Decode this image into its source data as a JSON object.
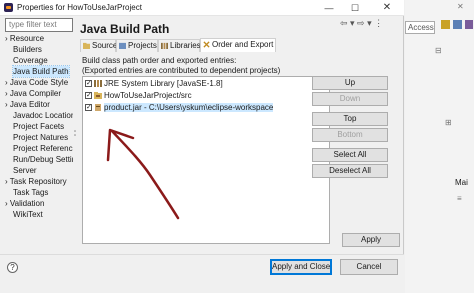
{
  "window": {
    "title": "Properties for HowToUseJarProject",
    "min": "—",
    "max": "☐",
    "close": "✕"
  },
  "filter": {
    "placeholder": "type filter text"
  },
  "tree": [
    {
      "label": "› Resource",
      "selected": false
    },
    {
      "label": "Builders",
      "selected": false
    },
    {
      "label": "Coverage",
      "selected": false
    },
    {
      "label": "Java Build Path",
      "selected": true
    },
    {
      "label": "› Java Code Style",
      "selected": false
    },
    {
      "label": "› Java Compiler",
      "selected": false
    },
    {
      "label": "› Java Editor",
      "selected": false
    },
    {
      "label": "Javadoc Location",
      "selected": false
    },
    {
      "label": "Project Facets",
      "selected": false
    },
    {
      "label": "Project Natures",
      "selected": false
    },
    {
      "label": "Project References",
      "selected": false
    },
    {
      "label": "Run/Debug Settings",
      "selected": false
    },
    {
      "label": "Server",
      "selected": false
    },
    {
      "label": "› Task Repository",
      "selected": false
    },
    {
      "label": "Task Tags",
      "selected": false
    },
    {
      "label": "› Validation",
      "selected": false
    },
    {
      "label": "WikiText",
      "selected": false
    }
  ],
  "page": {
    "title": "Java Build Path",
    "nav": "⇦ ▾ ⇨ ▾ ⋮"
  },
  "tabs": [
    {
      "label": "Source",
      "active": false
    },
    {
      "label": "Projects",
      "active": false
    },
    {
      "label": "Libraries",
      "active": false
    },
    {
      "label": "Order and Export",
      "active": true
    }
  ],
  "description": {
    "line1": "Build class path order and exported entries:",
    "line2": "(Exported entries are contributed to dependent projects)"
  },
  "entries": [
    {
      "label": "JRE System Library [JavaSE-1.8]",
      "checked": true,
      "selected": false,
      "icon": "library-icon"
    },
    {
      "label": "HowToUseJarProject/src",
      "checked": true,
      "selected": false,
      "icon": "source-folder-icon"
    },
    {
      "label": "product.jar - C:\\Users\\yskum\\eclipse-workspace",
      "checked": true,
      "selected": true,
      "icon": "jar-icon"
    }
  ],
  "buttons": {
    "up": "Up",
    "down": "Down",
    "top": "Top",
    "bottom": "Bottom",
    "select_all": "Select All",
    "deselect_all": "Deselect All",
    "apply": "Apply",
    "apply_close": "Apply and Close",
    "cancel": "Cancel"
  },
  "background": {
    "quick_access": "Access",
    "main_tab": "Mai"
  },
  "colors": {
    "selection": "#cce8ff",
    "annotation_arrow": "#8b1a1a",
    "default_button_border": "#0078d7"
  }
}
